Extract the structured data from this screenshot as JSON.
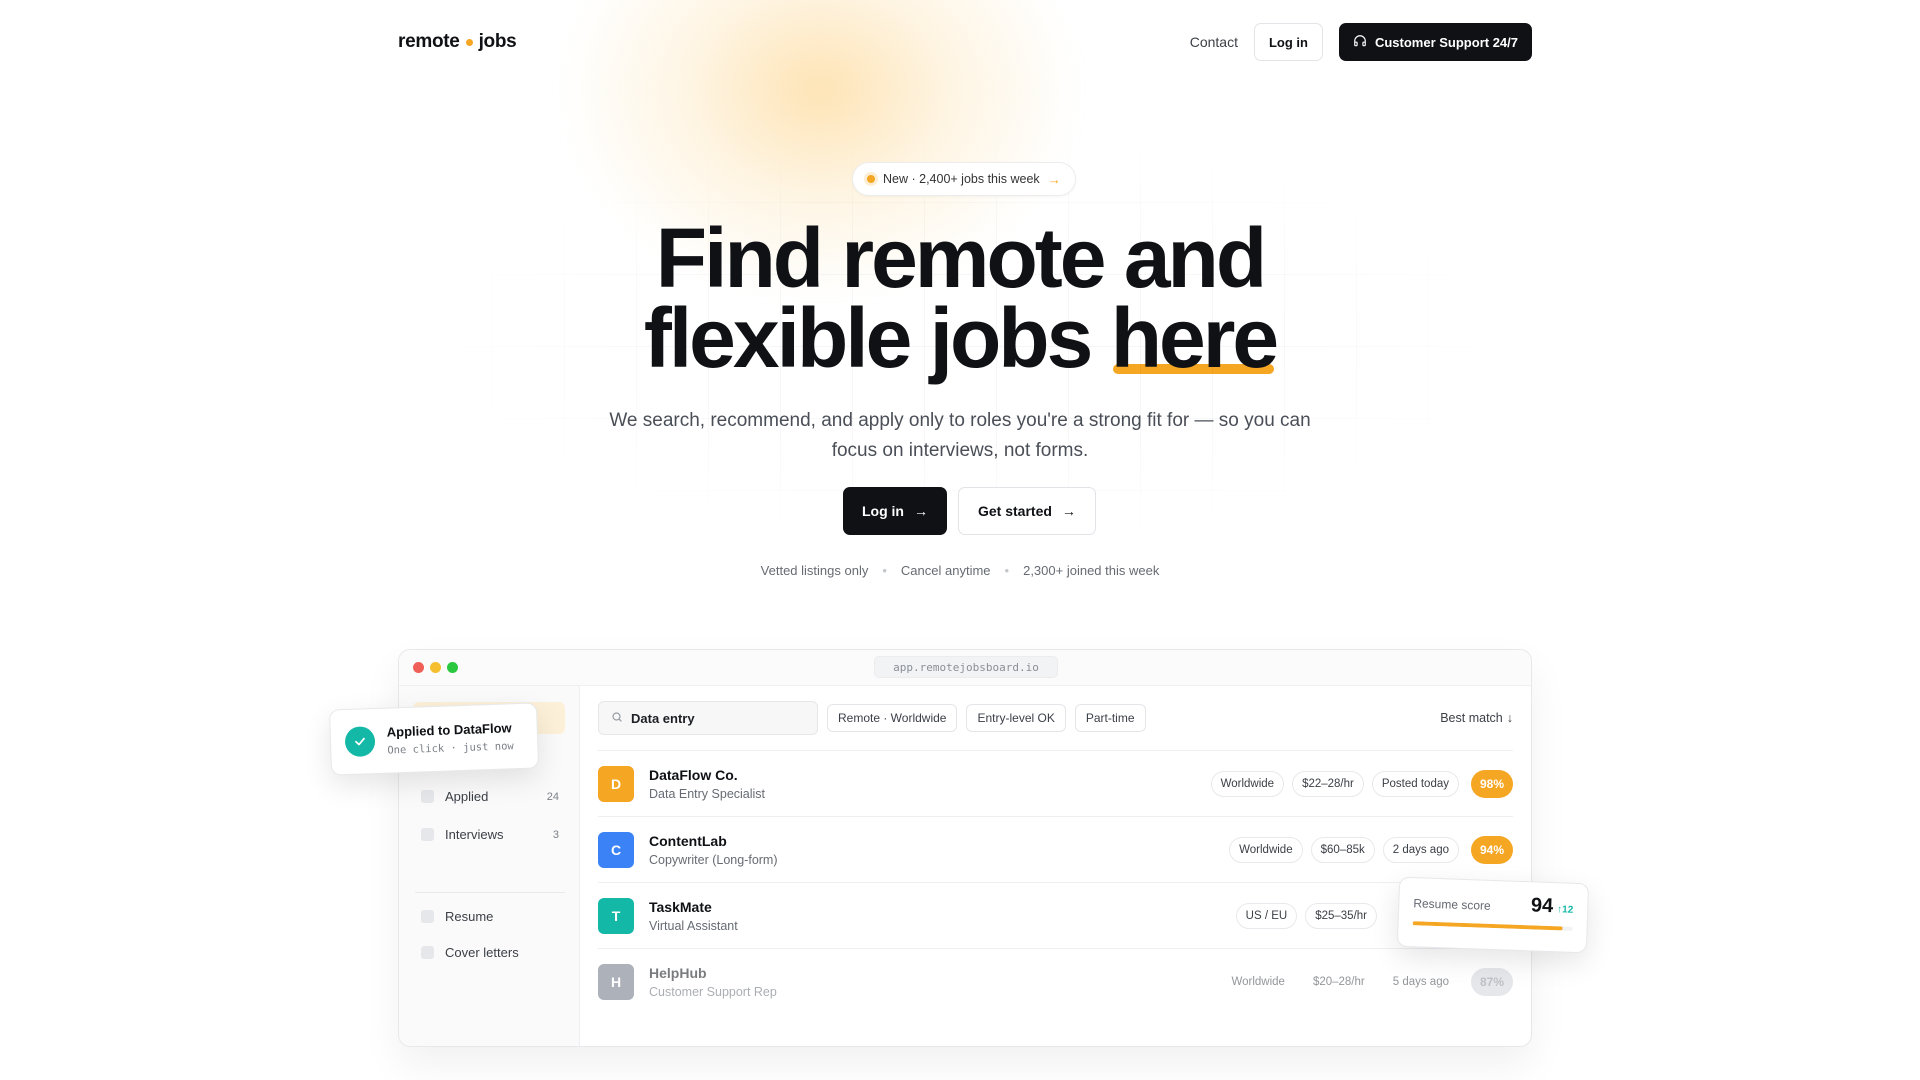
{
  "brand": {
    "name_left": "remote",
    "name_right": "jobs",
    "accent": "#f5a623"
  },
  "nav": {
    "contact": "Contact",
    "login": "Log in",
    "support": "Customer Support 24/7",
    "support_icon": "headset-icon"
  },
  "hero": {
    "badge": "New · 2,400+ jobs this week",
    "headline_line1": "Find remote and",
    "headline_line2_start": "flexible jobs",
    "headline_highlight": "here",
    "subtitle": "We search, recommend, and apply only to roles you're a strong fit for — so you can focus on interviews, not forms.",
    "cta_primary": "Log in",
    "cta_secondary": "Get started",
    "trust": [
      "Vetted listings only",
      "Cancel anytime",
      "2,300+ joined this week"
    ]
  },
  "app": {
    "url": "app.remotejobsboard.io",
    "sidebar": {
      "items": [
        {
          "label": "Applied",
          "count": "24"
        },
        {
          "label": "Interviews",
          "count": "3"
        }
      ],
      "secondary": [
        {
          "label": "Resume"
        },
        {
          "label": "Cover letters"
        }
      ]
    },
    "search_value": "Data entry",
    "filters": [
      "Remote · Worldwide",
      "Entry-level OK",
      "Part-time"
    ],
    "sort_label": "Best match",
    "jobs": [
      {
        "initial": "D",
        "company": "DataFlow Co.",
        "role": "Data Entry Specialist",
        "location": "Worldwide",
        "pay": "$22–28/hr",
        "posted": "Posted today",
        "match": "98%",
        "avatar_color": "#f5a623",
        "match_color": "#f5a623"
      },
      {
        "initial": "C",
        "company": "ContentLab",
        "role": "Copywriter (Long-form)",
        "location": "Worldwide",
        "pay": "$60–85k",
        "posted": "2 days ago",
        "match": "94%",
        "avatar_color": "#3b82f6",
        "match_color": "#f5a623"
      },
      {
        "initial": "T",
        "company": "TaskMate",
        "role": "Virtual Assistant",
        "location": "US / EU",
        "pay": "$25–35/hr",
        "posted": "",
        "match": "",
        "avatar_color": "#14b8a6",
        "match_color": "#f5a623"
      },
      {
        "initial": "H",
        "company": "HelpHub",
        "role": "Customer Support Rep",
        "location": "Worldwide",
        "pay": "$20–28/hr",
        "posted": "5 days ago",
        "match": "87%",
        "avatar_color": "#6b7280",
        "match_color": "#d1d5db"
      }
    ]
  },
  "toast": {
    "title": "Applied to DataFlow",
    "subtitle": "One click · just now"
  },
  "resume_card": {
    "label": "Resume score",
    "score": "94",
    "delta": "↑12",
    "progress": 0.94
  }
}
